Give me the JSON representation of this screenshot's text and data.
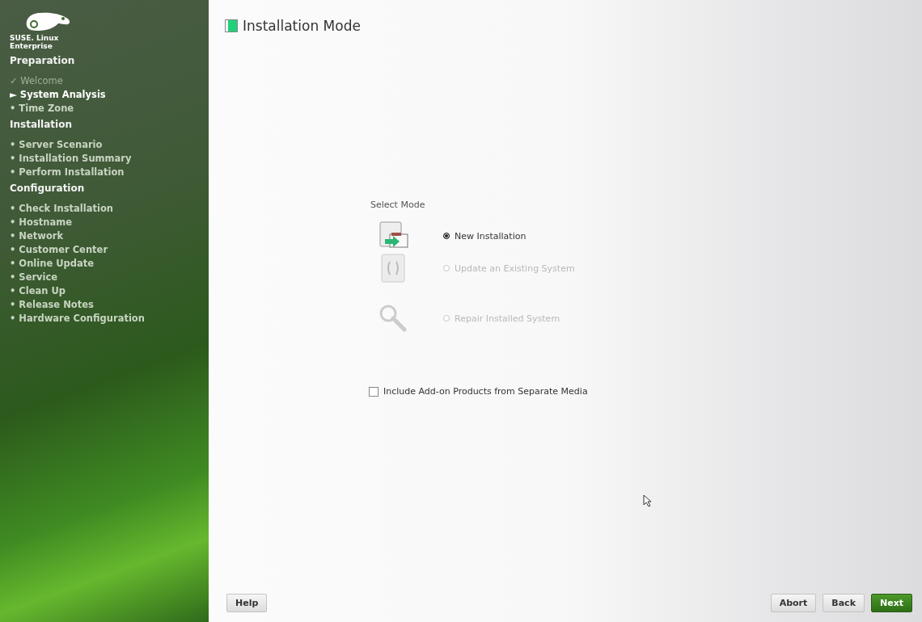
{
  "logo": {
    "text": [
      "SUSE. Linux",
      "Enterprise"
    ]
  },
  "sidebar": {
    "sections": [
      {
        "title": "Preparation",
        "steps": [
          {
            "bullet": "✓",
            "label": "Welcome",
            "done": true,
            "current": false
          },
          {
            "bullet": "►",
            "label": "System Analysis",
            "done": false,
            "current": true
          },
          {
            "bullet": "•",
            "label": "Time Zone",
            "done": false,
            "current": false
          }
        ]
      },
      {
        "title": "Installation",
        "steps": [
          {
            "bullet": "•",
            "label": "Server Scenario",
            "done": false,
            "current": false
          },
          {
            "bullet": "•",
            "label": "Installation Summary",
            "done": false,
            "current": false
          },
          {
            "bullet": "•",
            "label": "Perform Installation",
            "done": false,
            "current": false
          }
        ]
      },
      {
        "title": "Configuration",
        "steps": [
          {
            "bullet": "•",
            "label": "Check Installation",
            "done": false,
            "current": false
          },
          {
            "bullet": "•",
            "label": "Hostname",
            "done": false,
            "current": false
          },
          {
            "bullet": "•",
            "label": "Network",
            "done": false,
            "current": false
          },
          {
            "bullet": "•",
            "label": "Customer Center",
            "done": false,
            "current": false
          },
          {
            "bullet": "•",
            "label": "Online Update",
            "done": false,
            "current": false
          },
          {
            "bullet": "•",
            "label": "Service",
            "done": false,
            "current": false
          },
          {
            "bullet": "•",
            "label": "Clean Up",
            "done": false,
            "current": false
          },
          {
            "bullet": "•",
            "label": "Release Notes",
            "done": false,
            "current": false
          },
          {
            "bullet": "•",
            "label": "Hardware Configuration",
            "done": false,
            "current": false
          }
        ]
      }
    ]
  },
  "page": {
    "title": "Installation Mode",
    "group_label": "Select Mode",
    "options": [
      {
        "label": "New Installation",
        "selected": true,
        "disabled": false
      },
      {
        "label": "Update an Existing System",
        "selected": false,
        "disabled": true
      },
      {
        "label": "Repair Installed System",
        "selected": false,
        "disabled": true
      }
    ],
    "addon": {
      "label": "Include Add-on Products from Separate Media",
      "checked": false
    }
  },
  "buttons": {
    "left": [
      "Help"
    ],
    "right": [
      {
        "label": "Abort",
        "primary": false
      },
      {
        "label": "Back",
        "primary": false
      },
      {
        "label": "Next",
        "primary": true
      }
    ]
  }
}
